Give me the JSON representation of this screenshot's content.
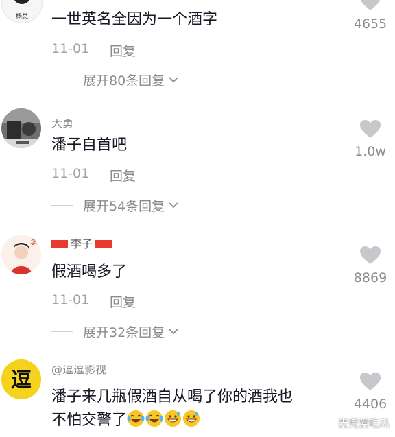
{
  "comments": [
    {
      "username": "",
      "text": "一世英名全因为一个酒字",
      "date": "11-01",
      "reply_label": "回复",
      "expand_label": "展开80条回复",
      "likes": "4655"
    },
    {
      "username": "大勇",
      "text": "潘子自首吧",
      "date": "11-01",
      "reply_label": "回复",
      "expand_label": "展开54条回复",
      "likes": "1.0w"
    },
    {
      "username": "李子",
      "text": "假酒喝多了",
      "date": "11-01",
      "reply_label": "回复",
      "expand_label": "展开32条回复",
      "likes": "8869"
    },
    {
      "username": "@逗逗影视",
      "text_line1": "潘子来几瓶假酒自从喝了你的酒我也",
      "text_line2": "不怕交警了",
      "likes": "4406"
    }
  ],
  "avatars": {
    "c1_badge": "杨总",
    "c3_name": "李子",
    "c4_glyph": "逗"
  },
  "watermark": "麦兜爱吃瓜",
  "icons": {
    "heart": "heart-icon",
    "chevron": "chevron-down-icon",
    "emoji_laugh": "laughing-tears-emoji",
    "emoji_grin": "grinning-sweat-emoji"
  },
  "colors": {
    "text_primary": "#161823",
    "text_secondary": "#8a8b91",
    "heart_gray": "#c8c8cc",
    "c4_avatar_yellow": "#f7d21c"
  }
}
